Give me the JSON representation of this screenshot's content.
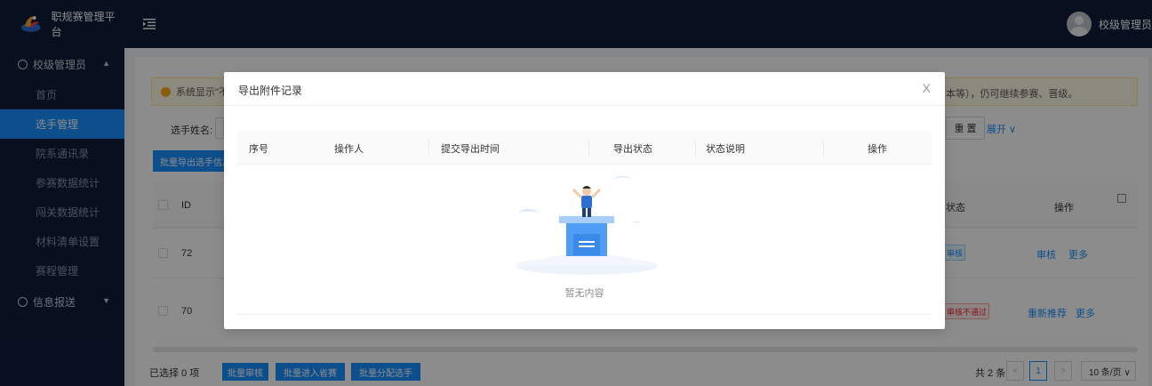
{
  "header": {
    "app_title": "职规赛管理平台",
    "user_greeting": "校级管理员,您好"
  },
  "sidebar": {
    "groups": [
      {
        "label": "校级管理员",
        "items": [
          {
            "label": "首页"
          },
          {
            "label": "选手管理",
            "active": true
          },
          {
            "label": "院系通讯录"
          },
          {
            "label": "参赛数据统计"
          },
          {
            "label": "闯关数据统计"
          },
          {
            "label": "材料清单设置"
          },
          {
            "label": "赛程管理"
          }
        ]
      },
      {
        "label": "信息报送"
      }
    ]
  },
  "page": {
    "alert_prefix": "系统显示\"不",
    "alert_suffix": "本等），仍可继续参赛、晋级。",
    "filter_label": "选手姓名:",
    "reset_label": "重 置",
    "expand_label": "展开 ∨",
    "export_button": "批量导出选手信息",
    "table": {
      "col_id": "ID",
      "col_status": "状态",
      "col_op": "操作",
      "rows": [
        {
          "id": "72",
          "status": "审核",
          "actions": [
            "审核",
            "更多"
          ]
        },
        {
          "id": "70",
          "status": "审核不通过",
          "actions": [
            "重新推荐",
            "更多"
          ]
        }
      ]
    },
    "footer": {
      "selected": "已选择 0 项",
      "buttons": [
        "批量审核",
        "批量进入省赛",
        "批量分配选手"
      ],
      "total": "共 2 条",
      "current_page": "1",
      "prev": "<",
      "next": ">",
      "page_size": "10 条/页 ∨"
    }
  },
  "modal": {
    "title": "导出附件记录",
    "close": "X",
    "columns": [
      "序号",
      "操作人",
      "提交导出时间",
      "导出状态",
      "状态说明",
      "操作"
    ],
    "empty_text": "暂无内容"
  },
  "colors": {
    "sidebar_bg": "#0f1c3a",
    "primary": "#1890ff",
    "warning": "#faad14",
    "danger": "#f5222d"
  }
}
